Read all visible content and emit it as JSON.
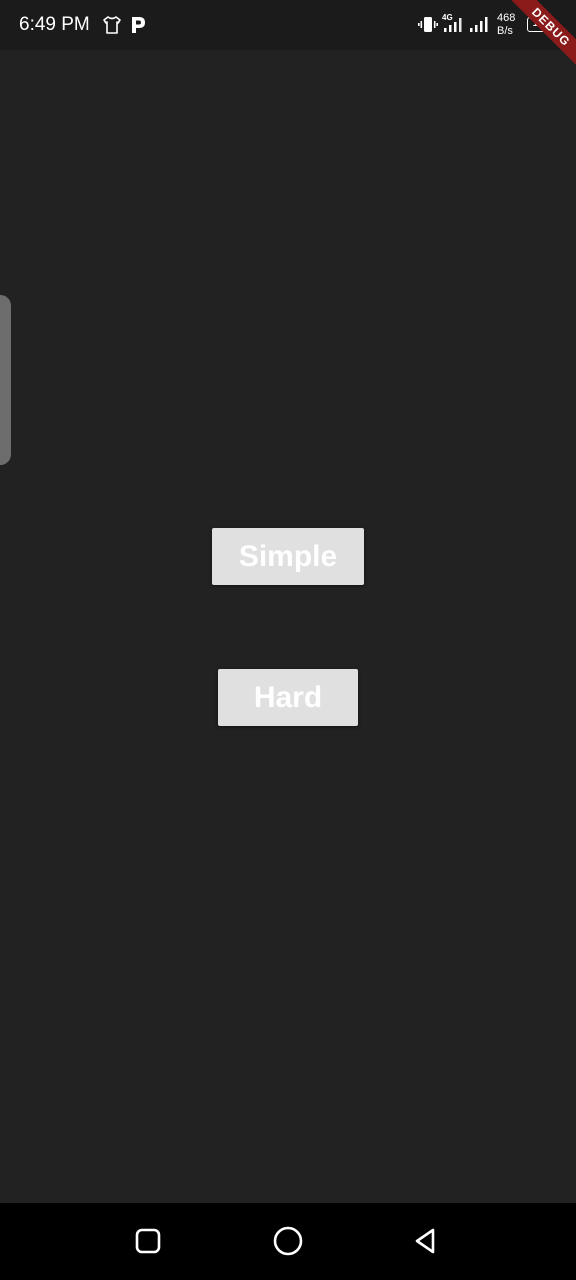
{
  "status_bar": {
    "time": "6:49 PM",
    "network_type": "4G",
    "net_speed_value": "468",
    "net_speed_unit": "B/s",
    "battery_level": "100",
    "icons": [
      "tshirt-icon",
      "p-app-icon",
      "vibrate-icon",
      "signal-4g-icon",
      "signal-icon"
    ]
  },
  "debug_banner": {
    "label": "DEBUG",
    "color": "#8b1a1a"
  },
  "main": {
    "simple_button_label": "Simple",
    "hard_button_label": "Hard"
  },
  "nav_bar": {
    "icons": [
      "recent-apps-icon",
      "home-icon",
      "back-icon"
    ]
  },
  "colors": {
    "background": "#222222",
    "button_bg": "#e0e0e0",
    "button_text": "#ffffff"
  }
}
